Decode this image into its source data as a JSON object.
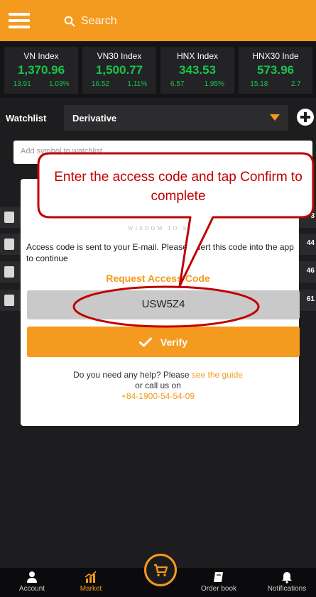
{
  "header": {
    "search_placeholder": "Search"
  },
  "indices": [
    {
      "name": "VN Index",
      "value": "1,370.96",
      "change": "13.91",
      "percent": "1.03%"
    },
    {
      "name": "VN30 Index",
      "value": "1,500.77",
      "change": "16.52",
      "percent": "1.11%"
    },
    {
      "name": "HNX Index",
      "value": "343.53",
      "change": "6.57",
      "percent": "1.95%"
    },
    {
      "name": "HNX30 Inde",
      "value": "573.96",
      "change": "15.18",
      "percent": "2.7"
    }
  ],
  "watchlist": {
    "label": "Watchlist",
    "selected": "Derivative",
    "add_placeholder": "Add symbol to watchlist",
    "row_numbers": [
      "3",
      "44",
      "46",
      "61"
    ]
  },
  "dialog": {
    "logo_tagline": "WISDOM TO SUCC",
    "message": "Access code is sent to your E-mail. Please insert this code into the app to continue",
    "request_label": "Request Access Code",
    "code": "USW5Z4",
    "verify_label": "Verify",
    "help_line1_prefix": "Do you need any help? Please ",
    "help_guide_link": "see the guide",
    "help_line2": "or call us on",
    "help_phone": "+84-1900-54-54-09"
  },
  "callout": {
    "text": "Enter the access code and tap Confirm to complete"
  },
  "colors": {
    "accent": "#f49a1e",
    "positive": "#19c44b",
    "annotation": "#c00000"
  },
  "bottom_nav": [
    {
      "label": "Account",
      "icon": "user-icon"
    },
    {
      "label": "Market",
      "icon": "chart-icon"
    },
    {
      "label": "Order book",
      "icon": "book-icon"
    },
    {
      "label": "Notifications",
      "icon": "bell-icon"
    }
  ]
}
